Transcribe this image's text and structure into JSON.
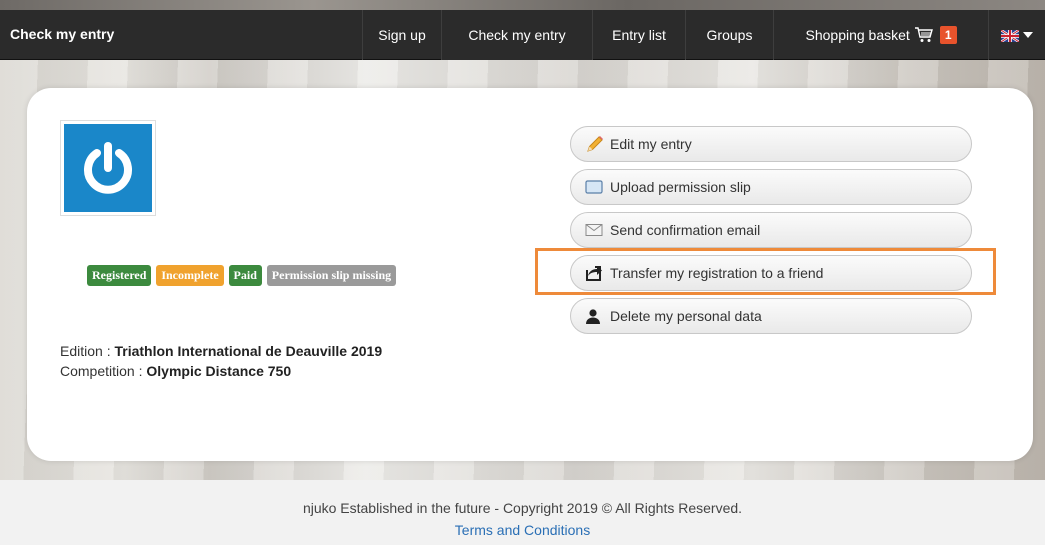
{
  "navbar": {
    "brand": "Check my entry",
    "items": [
      {
        "label": "Sign up"
      },
      {
        "label": "Check my entry"
      },
      {
        "label": "Entry list"
      },
      {
        "label": "Groups"
      },
      {
        "label": "Shopping basket"
      }
    ],
    "basket_count": "1",
    "basket_icon": "shopping-cart-icon",
    "language_icon": "uk-flag-icon"
  },
  "entry": {
    "badges": [
      "Registered",
      "Incomplete",
      "Paid",
      "Permission slip missing"
    ],
    "edition_label": "Edition : ",
    "edition_value": "Triathlon International de Deauville 2019",
    "competition_label": "Competition : ",
    "competition_value": "Olympic Distance 750"
  },
  "actions": [
    {
      "label": "Edit my entry",
      "icon": "pencil-icon"
    },
    {
      "label": "Upload permission slip",
      "icon": "upload-icon"
    },
    {
      "label": "Send confirmation email",
      "icon": "envelope-icon"
    },
    {
      "label": "Transfer my registration to a friend",
      "icon": "share-icon"
    },
    {
      "label": "Delete my personal data",
      "icon": "user-icon"
    }
  ],
  "footer": {
    "copyright": "njuko Established in the future - Copyright 2019 © All Rights Reserved.",
    "terms": "Terms and Conditions"
  },
  "colors": {
    "navbar": "#2b2b2b",
    "badge_green": "#3c8a3e",
    "badge_orange": "#f0a22e",
    "badge_grey": "#9a9a9a",
    "cart_badge": "#e8532c",
    "logo_blue": "#1a87c9",
    "highlight": "#ee8a3a",
    "link": "#2a6fb5"
  }
}
